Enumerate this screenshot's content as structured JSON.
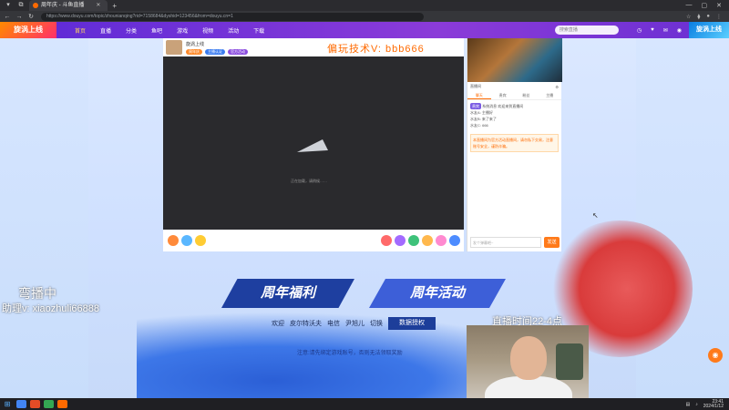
{
  "browser": {
    "tab_title": "周年庆 - 斗鱼直播",
    "url": "https://www.douyu.com/topic/zhounianqing?rid=7158684&dyshid=123456&from=douyu.cn=1",
    "win_min": "—",
    "win_max": "▢",
    "win_close": "✕"
  },
  "site": {
    "logo_left": "旋涡上线",
    "nav": [
      "首页",
      "直播",
      "分类",
      "鱼吧",
      "游戏",
      "视频",
      "活动",
      "下载"
    ],
    "search_placeholder": "搜索直播",
    "logo_right": "旋涡上线"
  },
  "stream": {
    "streamer_name": "旋涡上线",
    "tags": [
      "周年庆",
      "主播认证",
      "官方活动"
    ],
    "overlay_text": "偏玩技术V: bbb666",
    "loading_text": "正在加载，请稍候……"
  },
  "chat": {
    "title": "直播间",
    "tabs": [
      "聊天",
      "贵宾",
      "粉丝",
      "主播"
    ],
    "lines": [
      "系统消息 欢迎来到直播间",
      "水友A: 主播好",
      "水友B: 来了来了",
      "水友C: 666"
    ],
    "badge": "贵宾",
    "highlight": "本直播间为官方活动直播间，请勿私下交易，注意账号安全，谨防诈骗。",
    "input_placeholder": "发个弹幕吧~",
    "send_label": "发送"
  },
  "banners": {
    "welfare": "周年福利",
    "activity": "周年活动"
  },
  "info": {
    "labels": [
      "欢迎",
      "皮尔特沃夫",
      "电信",
      "尹旭儿",
      "切换"
    ],
    "auth_button": "数据授权",
    "notice": "注意:请先绑定游戏账号，否则无法领取奖励"
  },
  "overlays": {
    "left_title": "弯播中",
    "left_contact": "助理v: xiaozhuli66888",
    "stream_time": "直播时间22-4点"
  },
  "taskbar": {
    "time": "23:41",
    "date": "2024/1/12"
  },
  "colors": {
    "accent": "#ff6a00",
    "header_purple": "#6a2fd2",
    "banner_blue": "#1e3fa0"
  }
}
